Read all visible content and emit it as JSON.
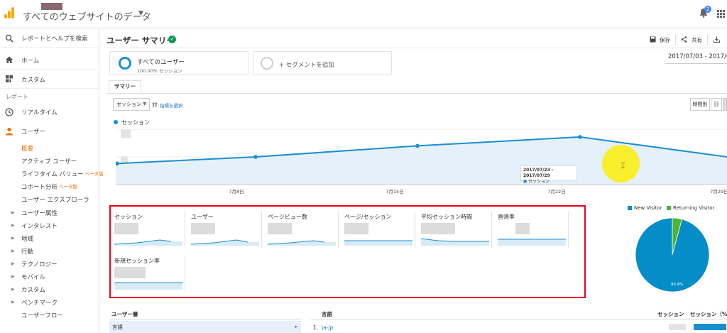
{
  "header": {
    "property_title": "すべてのウェブサイトのデータ",
    "notification_count": "2"
  },
  "sidebar": {
    "search_label": "レポートとヘルプを検索",
    "home_label": "ホーム",
    "custom_label": "カスタム",
    "reports_section": "レポート",
    "realtime_label": "リアルタイム",
    "users_label": "ユーザー",
    "sub_items": [
      {
        "label": "概要"
      },
      {
        "label": "アクティブ ユーザー"
      },
      {
        "label": "ライフタイム バリュー",
        "badge": "ベータ版"
      },
      {
        "label": "コホート分析",
        "badge": "ベータ版"
      },
      {
        "label": "ユーザー エクスプローラ"
      },
      {
        "label": "ユーザー属性"
      },
      {
        "label": "インタレスト"
      },
      {
        "label": "地域"
      },
      {
        "label": "行動"
      },
      {
        "label": "テクノロジー"
      },
      {
        "label": "モバイル"
      },
      {
        "label": "カスタム"
      },
      {
        "label": "ベンチマーク"
      },
      {
        "label": "ユーザーフロー"
      }
    ]
  },
  "main": {
    "title": "ユーザー サマリー",
    "toolbar": {
      "save": "保存",
      "share": "共有"
    },
    "segment": {
      "name": "すべてのユーザー",
      "sub": "100.00% セッション",
      "add": "+ セグメントを追加"
    },
    "date_range": "2017/07/03 - 2017/0",
    "tab": "サマリー",
    "metric_select": "セッション",
    "vs": "対",
    "pick_metric": "指標を選択",
    "granularity": {
      "hourly": "時間別",
      "day": "日"
    },
    "chart_legend": "セッション",
    "tooltip": {
      "date": "2017/07/23 - 2017/07/29",
      "metric": "セッション"
    }
  },
  "chart_data": {
    "type": "area",
    "x": [
      "2017/07/03",
      "2017/07/10",
      "2017/07/17",
      "2017/07/24",
      "2017/07/31"
    ],
    "tick_labels": [
      "7月8日",
      "7月15日",
      "7月22日",
      "7月29日"
    ],
    "series": [
      {
        "name": "セッション",
        "values": [
          0.38,
          0.5,
          0.7,
          0.86,
          0.5
        ]
      }
    ],
    "note_values": "relative scale (axis values masked)"
  },
  "metrics": [
    {
      "name": "セッション"
    },
    {
      "name": "ユーザー"
    },
    {
      "name": "ページビュー数"
    },
    {
      "name": "ページ/セッション"
    },
    {
      "name": "平均セッション時間"
    },
    {
      "name": "直帰率"
    },
    {
      "name": "新規セッション率"
    }
  ],
  "pie": {
    "new_visitor": "New Visitor",
    "returning_visitor": "Returning Visitor",
    "new_pct_label": "95.8%",
    "new_share": 0.958,
    "colors": {
      "new": "#058dc7",
      "returning": "#50b432"
    }
  },
  "table": {
    "left_header": "ユーザー層",
    "left_selected": "言語",
    "mid_header": "言語",
    "col_sessions": "セッション",
    "col_sessions_pct": "セッション（%）",
    "rows": [
      {
        "num": "1.",
        "value": "ja-jp"
      }
    ]
  }
}
